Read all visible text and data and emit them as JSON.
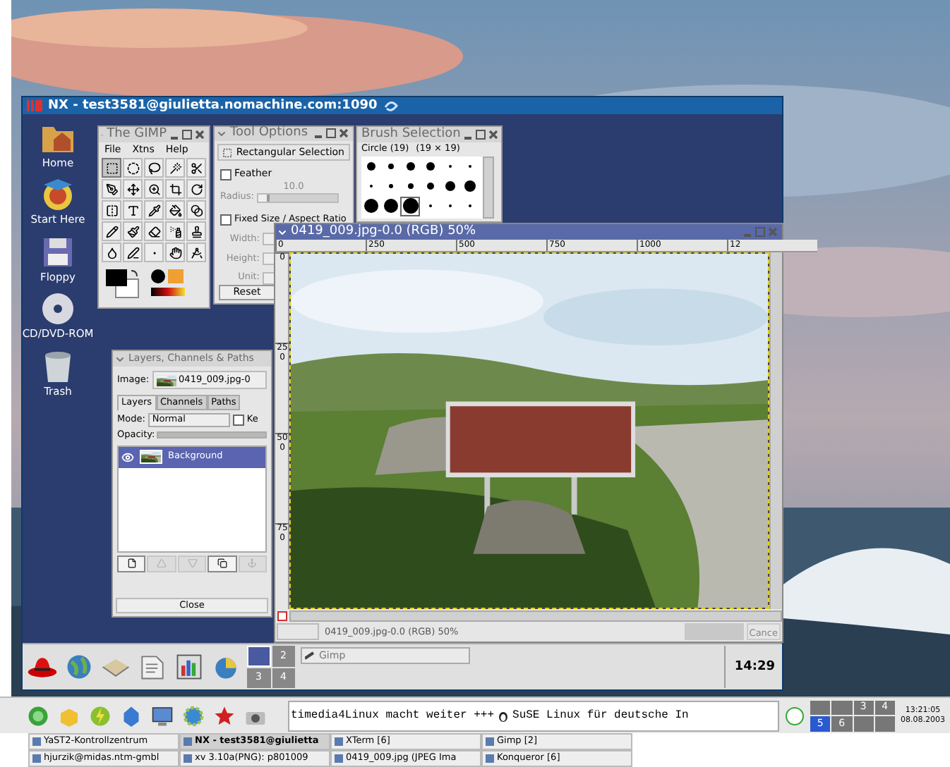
{
  "nx_window": {
    "title": "NX - test3581@giulietta.nomachine.com:1090",
    "desktop_icons": [
      {
        "label": "Home",
        "kind": "home"
      },
      {
        "label": "Start Here",
        "kind": "start"
      },
      {
        "label": "Floppy",
        "kind": "floppy"
      },
      {
        "label": "CD/DVD-ROM",
        "kind": "cd"
      },
      {
        "label": "Trash",
        "kind": "trash"
      }
    ],
    "toolbox": {
      "title": "The GIMP",
      "menu": [
        "File",
        "Xtns",
        "Help"
      ],
      "tools": [
        {
          "kind": "rect",
          "selected": true
        },
        {
          "kind": "ellipse",
          "selected": false
        },
        {
          "kind": "lasso",
          "selected": false
        },
        {
          "kind": "wand",
          "selected": false
        },
        {
          "kind": "scissors",
          "selected": false
        },
        {
          "kind": "bezier",
          "selected": false
        },
        {
          "kind": "move",
          "selected": false
        },
        {
          "kind": "zoom",
          "selected": false
        },
        {
          "kind": "crop",
          "selected": false
        },
        {
          "kind": "transform",
          "selected": false
        },
        {
          "kind": "flip",
          "selected": false
        },
        {
          "kind": "text",
          "selected": false
        },
        {
          "kind": "picker",
          "selected": false
        },
        {
          "kind": "bucket",
          "selected": false
        },
        {
          "kind": "gradient",
          "selected": false
        },
        {
          "kind": "pencil",
          "selected": false
        },
        {
          "kind": "brush",
          "selected": false
        },
        {
          "kind": "eraser",
          "selected": false
        },
        {
          "kind": "airbrush",
          "selected": false
        },
        {
          "kind": "clone",
          "selected": false
        },
        {
          "kind": "blur",
          "selected": false
        },
        {
          "kind": "ink",
          "selected": false
        },
        {
          "kind": "dodge",
          "selected": false
        },
        {
          "kind": "smudge",
          "selected": false
        },
        {
          "kind": "measure",
          "selected": false
        }
      ]
    },
    "tool_options": {
      "title": "Tool Options",
      "tool": "Rectangular Selection",
      "feather": {
        "label": "Feather",
        "checked": false
      },
      "radius": {
        "label": "Radius:",
        "value": "10.0",
        "level": 0.15
      },
      "fixed": {
        "label": "Fixed Size / Aspect Ratio",
        "checked": false
      },
      "fields": [
        "Width:",
        "Height:",
        "Unit:"
      ],
      "reset": "Reset"
    },
    "brushes": {
      "title": "Brush Selection",
      "name": "Circle (19)",
      "size": "(19 × 19)"
    },
    "image_window": {
      "title": "0419_009.jpg-0.0 (RGB) 50%",
      "hruler": [
        "0",
        "250",
        "500",
        "750",
        "1000",
        "12"
      ],
      "vruler": [
        "0",
        "250",
        "500",
        "750"
      ],
      "status": "0419_009.jpg-0.0 (RGB) 50%",
      "cancel": "Cance"
    },
    "layers_dialog": {
      "title": "Layers, Channels & Paths",
      "image_label": "Image:",
      "image": "0419_009.jpg-0",
      "tabs": [
        {
          "label": "Layers",
          "selected": true
        },
        {
          "label": "Channels",
          "selected": false
        },
        {
          "label": "Paths",
          "selected": false
        }
      ],
      "mode_label": "Mode:",
      "mode": "Normal",
      "keep": {
        "label": "Ke",
        "checked": false
      },
      "opacity": {
        "label": "Opacity:",
        "level": 1
      },
      "layers": [
        {
          "name": "Background",
          "selected": true,
          "visible": true
        }
      ],
      "buttons": [
        {
          "kind": "new",
          "disabled": false
        },
        {
          "kind": "raise",
          "disabled": true
        },
        {
          "kind": "lower",
          "disabled": true
        },
        {
          "kind": "duplicate",
          "disabled": false
        },
        {
          "kind": "anchor",
          "disabled": true
        }
      ],
      "close": "Close"
    },
    "panel": {
      "desks": [
        {
          "selected": true
        },
        {
          "label": "2",
          "selected": false
        },
        {
          "label": "3",
          "selected": false
        },
        {
          "label": "4",
          "selected": false
        }
      ],
      "task": "Gimp",
      "clock": "14:29"
    }
  },
  "kde_panel": {
    "ticker": [
      "timedia4Linux macht weiter +++",
      "SuSE Linux für deutsche In"
    ],
    "desks": [
      {
        "selected": false
      },
      {
        "selected": false
      },
      {
        "label": "3",
        "selected": false
      },
      {
        "label": "4",
        "selected": false
      },
      {
        "label": "5",
        "selected": true
      },
      {
        "label": "6",
        "selected": false
      },
      {
        "selected": false
      },
      {
        "selected": false
      }
    ],
    "time": "13:21:05",
    "date": "08.08.2003"
  },
  "taskbar": [
    {
      "label": "YaST2-Kontrollzentrum",
      "selected": false
    },
    {
      "label": "NX - test3581@giulietta",
      "selected": true
    },
    {
      "label": "XTerm [6]",
      "selected": false
    },
    {
      "label": "Gimp [2]",
      "selected": false
    },
    {
      "label": "hjurzik@midas.ntm-gmbl",
      "selected": false
    },
    {
      "label": "xv 3.10a(PNG): p801009",
      "selected": false
    },
    {
      "label": "0419_009.jpg (JPEG Ima",
      "selected": false
    },
    {
      "label": "Konqueror [6]",
      "selected": false
    }
  ]
}
